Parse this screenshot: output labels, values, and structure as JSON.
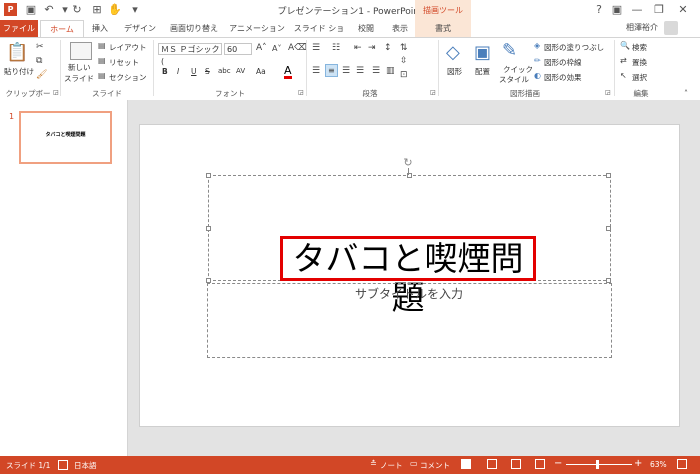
{
  "app": {
    "window_title": "プレゼンテーション1 - PowerPoint",
    "drawing_tools_label": "描画ツール",
    "user_name": "相澤裕介"
  },
  "tabs": [
    "ファイル",
    "ホーム",
    "挿入",
    "デザイン",
    "画面切り替え",
    "アニメーション",
    "スライド ショー",
    "校閲",
    "表示",
    "書式"
  ],
  "ribbon": {
    "clipboard": {
      "paste": "貼り付け",
      "label": "クリップボード"
    },
    "slides": {
      "new_slide_1": "新しい",
      "new_slide_2": "スライド",
      "layout": "レイアウト",
      "reset": "リセット",
      "section": "セクション",
      "label": "スライド"
    },
    "font": {
      "font_name": "ＭＳ Ｐゴシック (",
      "font_size": "60",
      "label": "フォント",
      "bold": "B",
      "italic": "I",
      "underline": "U",
      "strike": "S",
      "shadow": "abc",
      "spacing": "AV",
      "case": "Aa"
    },
    "paragraph": {
      "label": "段落"
    },
    "drawing": {
      "shapes": "図形",
      "arrange": "配置",
      "quick_style_1": "クイック",
      "quick_style_2": "スタイル",
      "fill": "図形の塗りつぶし",
      "outline": "図形の枠線",
      "effects": "図形の効果",
      "label": "図形描画"
    },
    "editing": {
      "find": "検索",
      "replace": "置換",
      "select": "選択",
      "label": "編集"
    }
  },
  "thumbnail": {
    "number": "1",
    "title": "タバコと喫煙問題"
  },
  "slide": {
    "title": "タバコと喫煙問題",
    "subtitle_placeholder": "サブタイトルを入力"
  },
  "status": {
    "slide": "スライド 1/1",
    "language": "日本語",
    "notes": "ノート",
    "comments": "コメント",
    "zoom": "63%"
  },
  "colors": {
    "accent": "#d24726",
    "highlight_border": "#e30000"
  }
}
